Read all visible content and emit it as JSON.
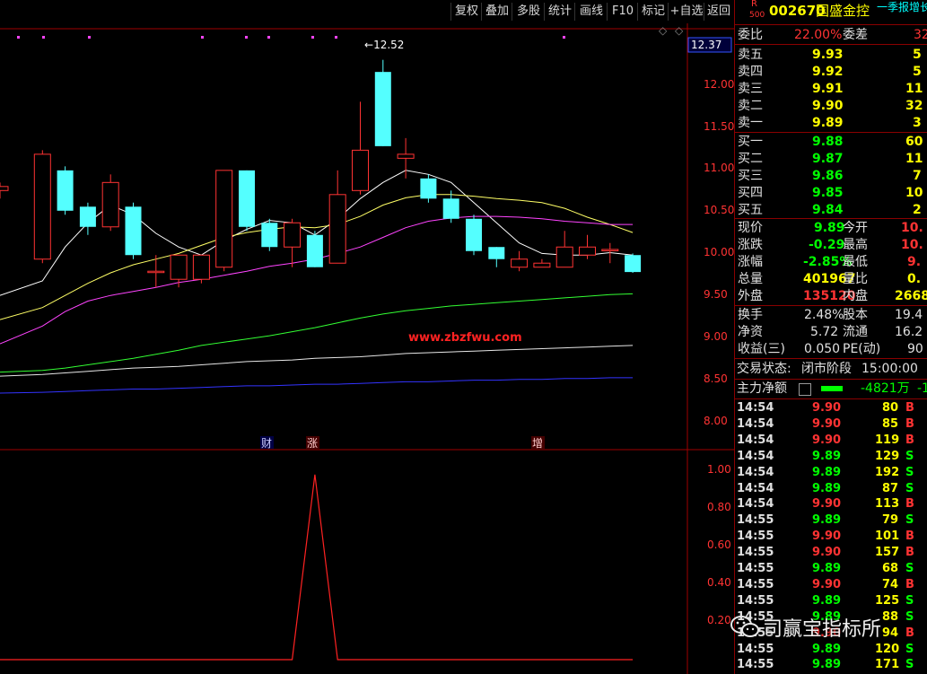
{
  "toolbar": {
    "buttons": [
      "复权",
      "叠加",
      "多股",
      "统计",
      "画线",
      "F10",
      "标记",
      "+自选",
      "返回"
    ]
  },
  "chart": {
    "price_labels": [
      "12.00",
      "11.50",
      "11.00",
      "10.50",
      "10.00",
      "9.50",
      "9.00",
      "8.50",
      "8.00"
    ],
    "current_price_label": "12.37",
    "high_annotation": "12.52",
    "url_watermark": "www.zbzfwu.com",
    "event_markers": [
      "财",
      "涨",
      "增"
    ],
    "indicator_labels": [
      "1.00",
      "0.80",
      "0.60",
      "0.40",
      "0.20"
    ],
    "colors": {
      "up": "#ff3333",
      "down": "#54ffff",
      "ma5": "#ffffff",
      "ma10": "#ffff66",
      "ma20": "#ff44ff",
      "ma60": "#33ff33",
      "ma120": "#e6e6e6",
      "ma250": "#3333ff",
      "indicator": "#ff2222"
    }
  },
  "chart_data": {
    "type": "candlestick",
    "ylim": [
      7.8,
      12.75
    ],
    "candles": [
      {
        "o": 10.9,
        "c": 10.95,
        "h": 11.0,
        "l": 10.8
      },
      {
        "o": 10.05,
        "c": 11.35,
        "h": 11.4,
        "l": 10.0
      },
      {
        "o": 11.15,
        "c": 10.65,
        "h": 11.2,
        "l": 10.6
      },
      {
        "o": 10.7,
        "c": 10.45,
        "h": 10.75,
        "l": 10.35
      },
      {
        "o": 10.45,
        "c": 11.0,
        "h": 11.1,
        "l": 10.4
      },
      {
        "o": 10.7,
        "c": 10.1,
        "h": 10.75,
        "l": 10.05
      },
      {
        "o": 9.9,
        "c": 9.9,
        "h": 10.1,
        "l": 9.7
      },
      {
        "o": 9.8,
        "c": 10.1,
        "h": 10.1,
        "l": 9.7
      },
      {
        "o": 9.8,
        "c": 10.1,
        "h": 10.1,
        "l": 9.75
      },
      {
        "o": 9.95,
        "c": 11.15,
        "h": 11.15,
        "l": 9.9
      },
      {
        "o": 11.15,
        "c": 10.45,
        "h": 11.15,
        "l": 10.4
      },
      {
        "o": 10.5,
        "c": 10.2,
        "h": 10.55,
        "l": 10.15
      },
      {
        "o": 10.2,
        "c": 10.5,
        "h": 10.55,
        "l": 9.95
      },
      {
        "o": 10.35,
        "c": 9.95,
        "h": 10.4,
        "l": 9.95
      },
      {
        "o": 10.0,
        "c": 10.85,
        "h": 11.15,
        "l": 10.0
      },
      {
        "o": 10.9,
        "c": 11.4,
        "h": 12.0,
        "l": 10.85
      },
      {
        "o": 12.37,
        "c": 11.45,
        "h": 12.52,
        "l": 11.45
      },
      {
        "o": 11.3,
        "c": 11.35,
        "h": 11.55,
        "l": 11.05
      },
      {
        "o": 11.05,
        "c": 10.8,
        "h": 11.1,
        "l": 10.75
      },
      {
        "o": 10.8,
        "c": 10.55,
        "h": 10.9,
        "l": 10.5
      },
      {
        "o": 10.55,
        "c": 10.15,
        "h": 10.6,
        "l": 10.1
      },
      {
        "o": 10.2,
        "c": 10.05,
        "h": 10.2,
        "l": 9.95
      },
      {
        "o": 9.95,
        "c": 10.05,
        "h": 10.15,
        "l": 9.9
      },
      {
        "o": 9.95,
        "c": 10.0,
        "h": 10.05,
        "l": 9.95
      },
      {
        "o": 9.95,
        "c": 10.2,
        "h": 10.4,
        "l": 9.95
      },
      {
        "o": 10.1,
        "c": 10.2,
        "h": 10.35,
        "l": 10.05
      },
      {
        "o": 10.17,
        "c": 10.17,
        "h": 10.25,
        "l": 10.0
      },
      {
        "o": 10.1,
        "c": 9.89,
        "h": 10.12,
        "l": 9.88
      }
    ],
    "ma_lines": [
      {
        "name": "ma5",
        "values": [
          9.6,
          9.78,
          10.2,
          10.5,
          10.72,
          10.6,
          10.37,
          10.2,
          10.1,
          10.28,
          10.42,
          10.53,
          10.5,
          10.35,
          10.55,
          10.8,
          11.0,
          11.15,
          11.1,
          11.0,
          10.75,
          10.5,
          10.25,
          10.12,
          10.1,
          10.1,
          10.13,
          10.1
        ]
      },
      {
        "name": "ma10",
        "values": [
          9.3,
          9.45,
          9.6,
          9.75,
          9.88,
          9.98,
          10.05,
          10.12,
          10.22,
          10.32,
          10.38,
          10.42,
          10.45,
          10.44,
          10.48,
          10.58,
          10.72,
          10.81,
          10.85,
          10.85,
          10.83,
          10.8,
          10.78,
          10.75,
          10.68,
          10.57,
          10.48,
          10.38
        ]
      },
      {
        "name": "ma20",
        "values": [
          9.0,
          9.22,
          9.4,
          9.53,
          9.6,
          9.65,
          9.7,
          9.76,
          9.8,
          9.85,
          9.9,
          9.96,
          10.0,
          10.05,
          10.12,
          10.2,
          10.32,
          10.44,
          10.52,
          10.56,
          10.58,
          10.58,
          10.57,
          10.55,
          10.52,
          10.5,
          10.48,
          10.48
        ]
      },
      {
        "name": "ma60",
        "values": [
          8.65,
          8.67,
          8.7,
          8.74,
          8.78,
          8.82,
          8.87,
          8.92,
          8.98,
          9.02,
          9.06,
          9.1,
          9.15,
          9.2,
          9.26,
          9.32,
          9.37,
          9.41,
          9.44,
          9.47,
          9.49,
          9.51,
          9.53,
          9.55,
          9.57,
          9.59,
          9.61,
          9.62
        ]
      },
      {
        "name": "ma120",
        "values": [
          8.6,
          8.62,
          8.64,
          8.66,
          8.68,
          8.7,
          8.71,
          8.72,
          8.74,
          8.76,
          8.78,
          8.79,
          8.8,
          8.82,
          8.83,
          8.84,
          8.86,
          8.88,
          8.89,
          8.9,
          8.91,
          8.92,
          8.93,
          8.94,
          8.95,
          8.96,
          8.97,
          8.98
        ]
      },
      {
        "name": "ma250",
        "values": [
          8.39,
          8.4,
          8.41,
          8.42,
          8.43,
          8.44,
          8.44,
          8.45,
          8.46,
          8.47,
          8.48,
          8.48,
          8.49,
          8.5,
          8.5,
          8.51,
          8.52,
          8.53,
          8.53,
          8.54,
          8.55,
          8.55,
          8.56,
          8.56,
          8.57,
          8.57,
          8.58,
          8.58
        ]
      }
    ],
    "indicator": {
      "ylim": [
        0,
        1.12
      ],
      "values": [
        0,
        0,
        0,
        0,
        0,
        0,
        0,
        0,
        0,
        0,
        0,
        0,
        0,
        1,
        0,
        0,
        0,
        0,
        0,
        0,
        0,
        0,
        0,
        0,
        0,
        0,
        0,
        0
      ]
    },
    "event_candles": [
      11,
      13,
      23
    ]
  },
  "panel": {
    "header": {
      "flag": "R",
      "flag_sub": "500",
      "code": "002670",
      "name": "国盛金控",
      "scroll": "一季报增长股"
    },
    "weibi": {
      "label": "委比",
      "value": "22.00%",
      "label2": "委差",
      "value2": "32"
    },
    "asks": [
      {
        "label": "卖五",
        "price": "9.93",
        "vol": "5"
      },
      {
        "label": "卖四",
        "price": "9.92",
        "vol": "5"
      },
      {
        "label": "卖三",
        "price": "9.91",
        "vol": "11"
      },
      {
        "label": "卖二",
        "price": "9.90",
        "vol": "32"
      },
      {
        "label": "卖一",
        "price": "9.89",
        "vol": "3"
      }
    ],
    "bids": [
      {
        "label": "买一",
        "price": "9.88",
        "vol": "60"
      },
      {
        "label": "买二",
        "price": "9.87",
        "vol": "11"
      },
      {
        "label": "买三",
        "price": "9.86",
        "vol": "7"
      },
      {
        "label": "买四",
        "price": "9.85",
        "vol": "10"
      },
      {
        "label": "买五",
        "price": "9.84",
        "vol": "2"
      }
    ],
    "quote": [
      {
        "l1": "现价",
        "v1": "9.89",
        "l2": "今开",
        "v2": "10."
      },
      {
        "l1": "涨跌",
        "v1": "-0.29",
        "l2": "最高",
        "v2": "10."
      },
      {
        "l1": "涨幅",
        "v1": "-2.85%",
        "l2": "最低",
        "v2": "9."
      },
      {
        "l1": "总量",
        "v1": "401967",
        "l2": "量比",
        "v2": "0."
      },
      {
        "l1": "外盘",
        "v1": "135120",
        "l2": "内盘",
        "v2": "2668"
      }
    ],
    "stats": [
      {
        "l1": "换手",
        "v1": "2.48%",
        "l2": "股本",
        "v2": "19.4"
      },
      {
        "l1": "净资",
        "v1": "5.72",
        "l2": "流通",
        "v2": "16.2"
      },
      {
        "l1": "收益(三)",
        "v1": "0.050",
        "l2": "PE(动)",
        "v2": "90"
      }
    ],
    "trade_status": {
      "label": "交易状态:",
      "value": "闭市阶段",
      "time": "15:00:00"
    },
    "main_net": {
      "label": "主力净额",
      "value": "-4821万",
      "extra": "-1"
    },
    "ticks": [
      {
        "time": "14:54",
        "price": "9.90",
        "vol": "80",
        "bs": "B"
      },
      {
        "time": "14:54",
        "price": "9.90",
        "vol": "85",
        "bs": "B"
      },
      {
        "time": "14:54",
        "price": "9.90",
        "vol": "119",
        "bs": "B"
      },
      {
        "time": "14:54",
        "price": "9.89",
        "vol": "129",
        "bs": "S"
      },
      {
        "time": "14:54",
        "price": "9.89",
        "vol": "192",
        "bs": "S"
      },
      {
        "time": "14:54",
        "price": "9.89",
        "vol": "87",
        "bs": "S"
      },
      {
        "time": "14:54",
        "price": "9.90",
        "vol": "113",
        "bs": "B"
      },
      {
        "time": "14:55",
        "price": "9.89",
        "vol": "79",
        "bs": "S"
      },
      {
        "time": "14:55",
        "price": "9.90",
        "vol": "101",
        "bs": "B"
      },
      {
        "time": "14:55",
        "price": "9.90",
        "vol": "157",
        "bs": "B"
      },
      {
        "time": "14:55",
        "price": "9.89",
        "vol": "68",
        "bs": "S"
      },
      {
        "time": "14:55",
        "price": "9.90",
        "vol": "74",
        "bs": "B"
      },
      {
        "time": "14:55",
        "price": "9.89",
        "vol": "125",
        "bs": "S"
      },
      {
        "time": "14:55",
        "price": "9.89",
        "vol": "88",
        "bs": "S"
      },
      {
        "time": "14:55",
        "price": "9.90",
        "vol": "94",
        "bs": "B"
      },
      {
        "time": "14:55",
        "price": "9.89",
        "vol": "120",
        "bs": "S"
      },
      {
        "time": "14:55",
        "price": "9.89",
        "vol": "171",
        "bs": "S"
      }
    ],
    "watermark": {
      "text": "司赢宝指标所"
    }
  }
}
